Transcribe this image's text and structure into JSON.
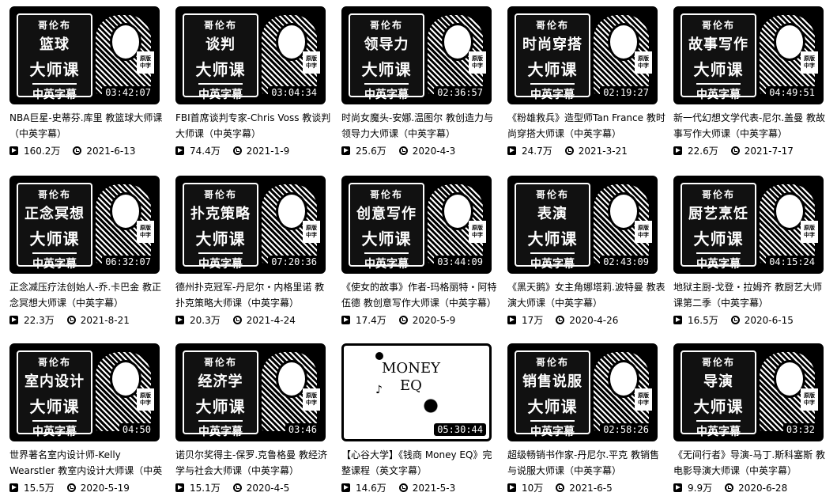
{
  "videos": [
    {
      "series": "哥伦布",
      "topic": "篮球",
      "main": "大师课",
      "sub": "中英字幕",
      "tag": "原版\n中字",
      "duration": "03:42:07",
      "title": "NBA巨星-史蒂芬.库里 教篮球大师课（中英字幕）",
      "views": "160.2万",
      "date": "2021-6-13"
    },
    {
      "series": "哥伦布",
      "topic": "谈判",
      "main": "大师课",
      "sub": "中英字幕",
      "tag": "原版\n中字",
      "duration": "03:04:34",
      "title": "FBI首席谈判专家-Chris Voss 教谈判大师课（中英字幕）",
      "views": "74.4万",
      "date": "2021-1-9"
    },
    {
      "series": "哥伦布",
      "topic": "领导力",
      "main": "大师课",
      "sub": "中英字幕",
      "tag": "原版\n中字",
      "duration": "02:36:57",
      "title": "时尚女魔头-安娜.温图尔 教创造力与领导力大师课（中英字幕）",
      "views": "25.6万",
      "date": "2020-4-3"
    },
    {
      "series": "哥伦布",
      "topic": "时尚穿搭",
      "main": "大师课",
      "sub": "中英字幕",
      "tag": "原版\n中字",
      "duration": "02:19:27",
      "title": "《粉雄救兵》造型师Tan France 教时尚穿搭大师课（中英字幕）",
      "views": "24.7万",
      "date": "2021-3-21"
    },
    {
      "series": "哥伦布",
      "topic": "故事写作",
      "main": "大师课",
      "sub": "中英字幕",
      "tag": "原版\n中字",
      "duration": "04:49:51",
      "title": "新一代幻想文学代表-尼尔.盖曼 教故事写作大师课（中英字幕）",
      "views": "22.6万",
      "date": "2021-7-17"
    },
    {
      "series": "哥伦布",
      "topic": "正念冥想",
      "main": "大师课",
      "sub": "中英字幕",
      "tag": "原版\n中字",
      "duration": "06:32:07",
      "title": "正念减压疗法创始人-乔.卡巴金 教正念冥想大师课（中英字幕）",
      "views": "22.3万",
      "date": "2021-8-21"
    },
    {
      "series": "哥伦布",
      "topic": "扑克策略",
      "main": "大师课",
      "sub": "中英字幕",
      "tag": "原版\n中字",
      "duration": "07:20:36",
      "title": "德州扑克冠军-丹尼尔・内格里诺 教扑克策略大师课（中英字幕）",
      "views": "20.3万",
      "date": "2021-4-24"
    },
    {
      "series": "哥伦布",
      "topic": "创意写作",
      "main": "大师课",
      "sub": "中英字幕",
      "tag": "原版\n中字",
      "duration": "03:44:09",
      "title": "《使女的故事》作者-玛格丽特・阿特伍德 教创意写作大师课（中英字幕）",
      "views": "17.4万",
      "date": "2020-5-9"
    },
    {
      "series": "哥伦布",
      "topic": "表演",
      "main": "大师课",
      "sub": "中英字幕",
      "tag": "原版\n中字",
      "duration": "02:43:09",
      "title": "《黑天鹅》女主角娜塔莉.波特曼 教表演大师课（中英字幕）",
      "views": "17万",
      "date": "2020-4-26"
    },
    {
      "series": "哥伦布",
      "topic": "厨艺烹饪",
      "main": "大师课",
      "sub": "中英字幕",
      "tag": "原版\n中字",
      "duration": "04:15:24",
      "title": "地狱主厨-戈登・拉姆齐 教厨艺大师课第二季（中英字幕）",
      "views": "16.5万",
      "date": "2020-6-15"
    },
    {
      "series": "哥伦布",
      "topic": "室内设计",
      "main": "大师课",
      "sub": "中英字幕",
      "tag": "原版\n中字",
      "duration": "04:50",
      "title": "世界著名室内设计师-Kelly Wearstler 教室内设计大师课（中英字幕）",
      "views": "15.5万",
      "date": "2020-5-19"
    },
    {
      "series": "哥伦布",
      "topic": "经济学",
      "main": "大师课",
      "sub": "中英字幕",
      "tag": "原版\n中字",
      "duration": "03:46",
      "title": "诺贝尔奖得主-保罗.克鲁格曼 教经济学与社会大师课（中英字幕）",
      "views": "15.1万",
      "date": "2020-4-5"
    },
    {
      "money": true,
      "money_line1": "MONEY",
      "money_line2": "EQ",
      "duration": "05:30:44",
      "title": "【心谷大学】《钱商 Money EQ》完整课程（英文字幕）",
      "views": "14.6万",
      "date": "2021-5-3"
    },
    {
      "series": "哥伦布",
      "topic": "销售说服",
      "main": "大师课",
      "sub": "中英字幕",
      "tag": "原版\n中字",
      "duration": "02:58:26",
      "title": "超级畅销书作家-丹尼尔.平克 教销售与说服大师课（中英字幕）",
      "views": "10万",
      "date": "2021-6-5"
    },
    {
      "series": "哥伦布",
      "topic": "导演",
      "main": "大师课",
      "sub": "中英字幕",
      "tag": "原版\n中字",
      "duration": "03:32",
      "title": "《无间行者》导演-马丁.斯科塞斯 教电影导演大师课（中英字幕）",
      "views": "9.9万",
      "date": "2020-6-28"
    }
  ]
}
